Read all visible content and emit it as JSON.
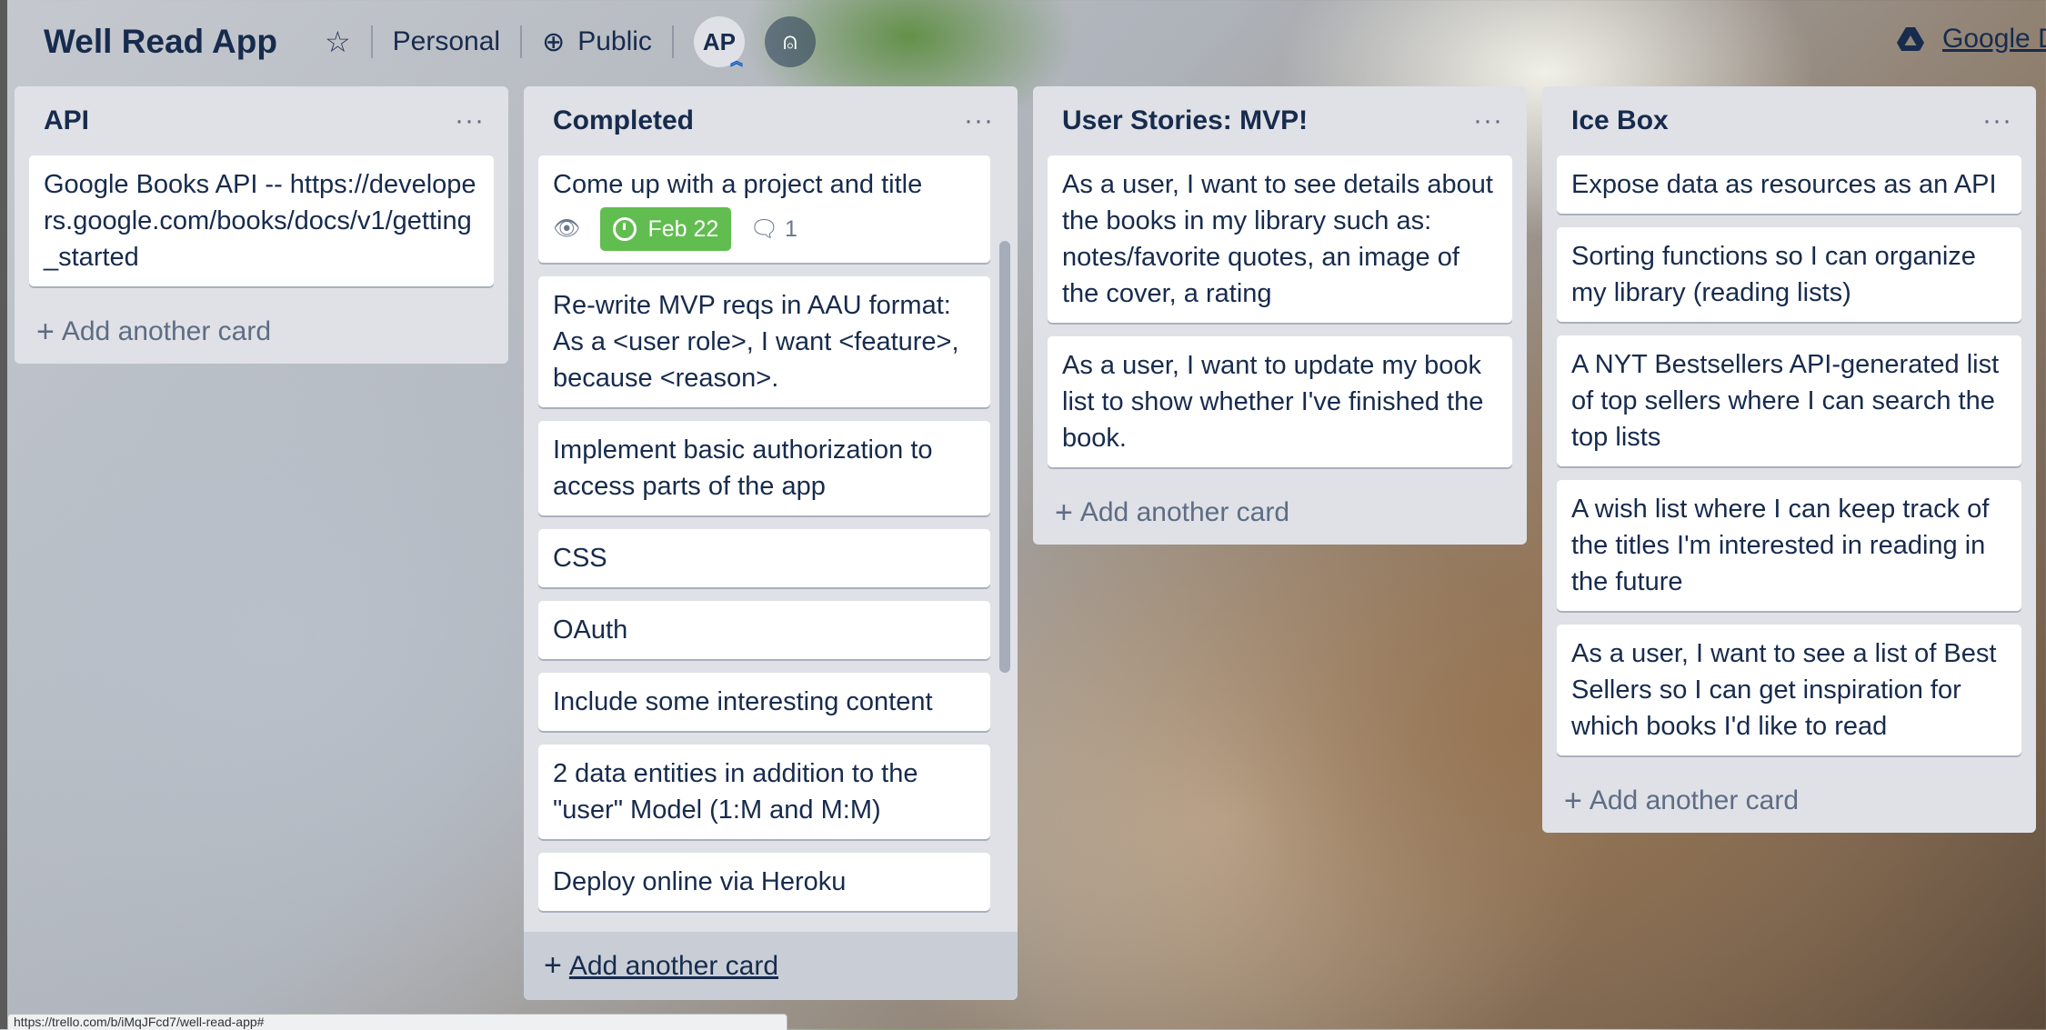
{
  "board": {
    "title": "Well Read App",
    "visibility_team": "Personal",
    "visibility_public": "Public",
    "avatar_initials": "AP",
    "powerup_label": "Google Drive"
  },
  "lists": [
    {
      "title": "API",
      "cards": [
        "Google Books API -- https://developers.google.com/books/docs/v1/getting_started"
      ],
      "add_card_label": "Add another card"
    },
    {
      "title": "Completed",
      "cards": [
        "Come up with a project and title",
        "Re-write MVP reqs in AAU format: As a <user role>, I want <feature>, because <reason>.",
        "Implement basic authorization to access parts of the app",
        "CSS",
        "OAuth",
        "Include some interesting content",
        "2 data entities in addition to the \"user\" Model (1:M and M:M)",
        "Deploy online via Heroku"
      ],
      "first_card_badges": {
        "due": "Feb 22",
        "comments": "1"
      },
      "add_card_label": "Add another card"
    },
    {
      "title": "User Stories: MVP!",
      "cards": [
        "As a user, I want to see details about the books in my library such as: notes/favorite quotes, an image of the cover, a rating",
        "As a user, I want to update my book list to show whether I've finished the book."
      ],
      "add_card_label": "Add another card"
    },
    {
      "title": "Ice Box",
      "cards": [
        "Expose data as resources as an API",
        "Sorting functions so I can organize my library (reading lists)",
        "A NYT Bestsellers API-generated list of top sellers where I can search the top lists",
        "A wish list where I can keep track of the titles I'm interested in reading in the future",
        "As a user, I want to see a list of Best Sellers so I can get inspiration for which books I'd like to read"
      ],
      "add_card_label": "Add another card"
    }
  ],
  "status_url": "https://trello.com/b/iMqJFcd7/well-read-app#",
  "colors": {
    "due_badge": "#61bd4f",
    "list_bg": "#dfe1e6",
    "text": "#172b4d"
  }
}
